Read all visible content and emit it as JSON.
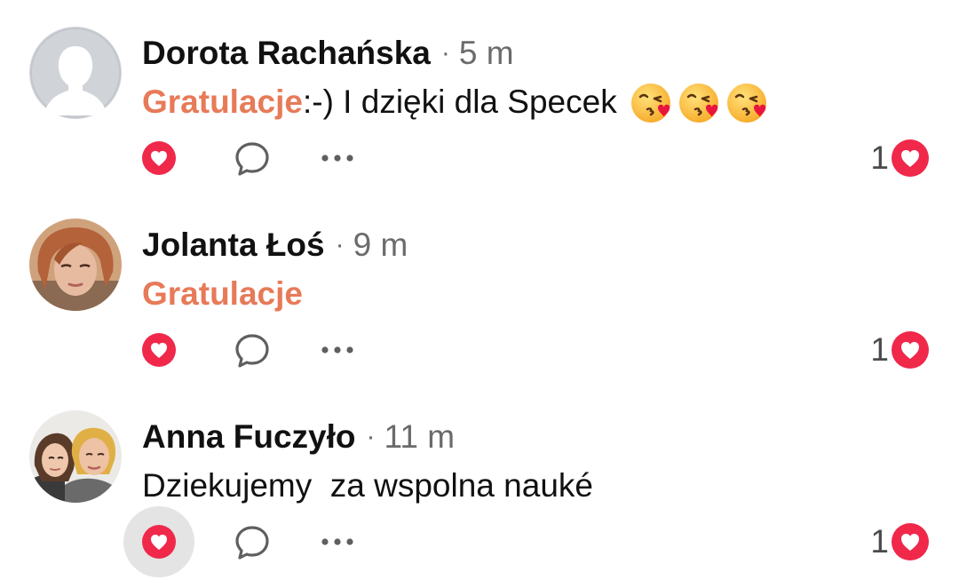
{
  "comments": [
    {
      "author": "Dorota Rachańska",
      "separator": "·",
      "time": "5 m",
      "mention": "Gratulacje",
      "text": ":-) I dzięki dla Specek",
      "emojis": [
        "kissing-face-heart-icon",
        "kissing-face-heart-icon",
        "kissing-face-heart-icon"
      ],
      "avatar": "default-female-silhouette",
      "reaction_count": "1",
      "reaction_type": "love-icon"
    },
    {
      "author": "Jolanta Łoś",
      "separator": "·",
      "time": "9 m",
      "mention": "Gratulacje",
      "text": "",
      "avatar": "user-photo",
      "reaction_count": "1",
      "reaction_type": "love-icon"
    },
    {
      "author": "Anna Fuczyło",
      "separator": "·",
      "time": "11 m",
      "text": "Dziekujemy  za wspolna nauké",
      "avatar": "user-photo",
      "reaction_count": "1",
      "reaction_type": "love-icon",
      "love_pressed": true
    }
  ],
  "colors": {
    "mention": "#e77a58",
    "love": "#f0284a",
    "meta_text": "#6b6b6b",
    "pressed_bg": "#e4e4e4"
  }
}
